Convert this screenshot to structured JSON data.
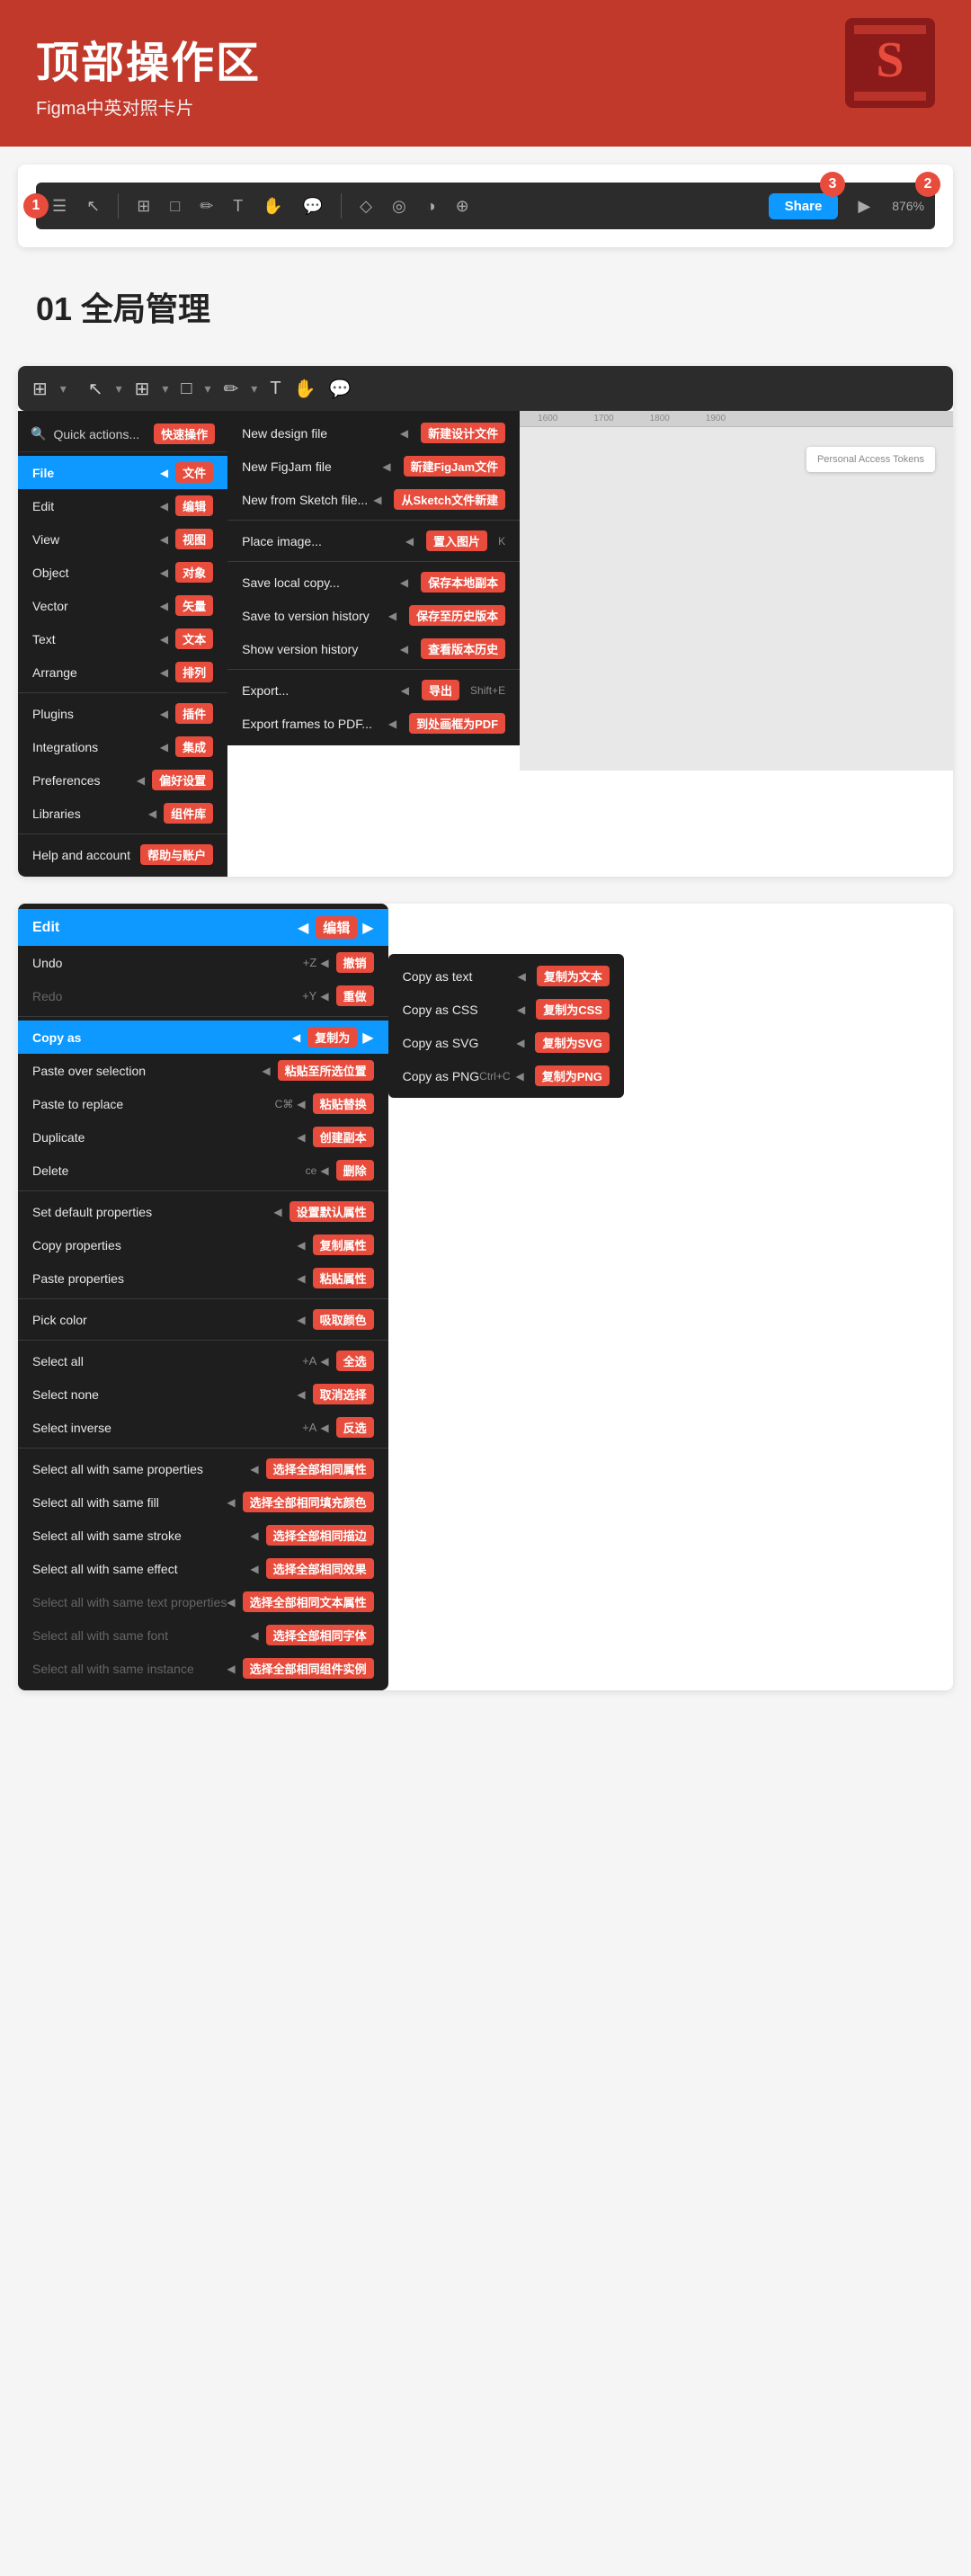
{
  "header": {
    "title": "顶部操作区",
    "subtitle": "Figma中英对照卡片"
  },
  "section01": {
    "label": "01 全局管理"
  },
  "toolbar": {
    "share_label": "Share",
    "zoom_label": "876%",
    "badge1": "1",
    "badge2": "2",
    "badge3": "3"
  },
  "mainMenu": {
    "search_text": "Quick actions...",
    "search_badge": "快速操作",
    "items": [
      {
        "id": "file",
        "en": "File",
        "cn": "文件",
        "active": true,
        "arrow": true
      },
      {
        "id": "edit",
        "en": "Edit",
        "cn": "编辑",
        "active": false,
        "arrow": true
      },
      {
        "id": "view",
        "en": "View",
        "cn": "视图",
        "active": false,
        "arrow": true
      },
      {
        "id": "object",
        "en": "Object",
        "cn": "对象",
        "active": false,
        "arrow": true
      },
      {
        "id": "vector",
        "en": "Vector",
        "cn": "矢量",
        "active": false,
        "arrow": true
      },
      {
        "id": "text",
        "en": "Text",
        "cn": "文本",
        "active": false,
        "arrow": true
      },
      {
        "id": "arrange",
        "en": "Arrange",
        "cn": "排列",
        "active": false,
        "arrow": true
      },
      {
        "id": "plugins",
        "en": "Plugins",
        "cn": "插件",
        "active": false,
        "arrow": true
      },
      {
        "id": "integrations",
        "en": "Integrations",
        "cn": "集成",
        "active": false,
        "arrow": true
      },
      {
        "id": "preferences",
        "en": "Preferences",
        "cn": "偏好设置",
        "active": false,
        "arrow": true
      },
      {
        "id": "libraries",
        "en": "Libraries",
        "cn": "组件库",
        "active": false,
        "arrow": true
      },
      {
        "id": "help",
        "en": "Help and account",
        "cn": "帮助与账户",
        "active": false,
        "arrow": false
      }
    ]
  },
  "fileMenu": {
    "items": [
      {
        "id": "new-design",
        "en": "New design file",
        "cn": "新建设计文件",
        "shortcut": "",
        "arrow": false
      },
      {
        "id": "new-figjam",
        "en": "New FigJam file",
        "cn": "新建FigJam文件",
        "shortcut": "",
        "arrow": false
      },
      {
        "id": "new-sketch",
        "en": "New from Sketch file...",
        "cn": "从Sketch文件新建",
        "shortcut": "",
        "arrow": false
      },
      {
        "id": "divider1",
        "type": "divider"
      },
      {
        "id": "place-image",
        "en": "Place image...",
        "cn": "置入图片",
        "shortcut": "K",
        "arrow": false
      },
      {
        "id": "divider2",
        "type": "divider"
      },
      {
        "id": "save-local",
        "en": "Save local copy...",
        "cn": "保存本地副本",
        "shortcut": "",
        "arrow": false
      },
      {
        "id": "save-version",
        "en": "Save to version history",
        "cn": "保存至历史版本",
        "shortcut": "",
        "arrow": false
      },
      {
        "id": "show-version",
        "en": "Show version history",
        "cn": "查看版本历史",
        "shortcut": "",
        "arrow": false
      },
      {
        "id": "divider3",
        "type": "divider"
      },
      {
        "id": "export",
        "en": "Export...",
        "cn": "导出",
        "shortcut": "Shift+E",
        "arrow": false
      },
      {
        "id": "export-pdf",
        "en": "Export frames to PDF...",
        "cn": "到处画框为PDF",
        "shortcut": "",
        "arrow": false
      }
    ]
  },
  "editSection": {
    "header_en": "Edit",
    "header_cn": "编辑",
    "items": [
      {
        "id": "undo",
        "en": "Undo",
        "cn": "撤销",
        "shortcut": "+Z",
        "active": false,
        "grayed": false
      },
      {
        "id": "redo",
        "en": "Redo",
        "cn": "重做",
        "shortcut": "+Y",
        "active": false,
        "grayed": true
      },
      {
        "id": "divider1",
        "type": "divider"
      },
      {
        "id": "copy-as",
        "en": "Copy as",
        "cn": "复制为",
        "active": true,
        "grayed": false,
        "arrow": true
      },
      {
        "id": "paste-over",
        "en": "Paste over selection",
        "cn": "粘贴至所选位置",
        "active": false,
        "grayed": false
      },
      {
        "id": "paste-replace",
        "en": "Paste to replace",
        "cn": "粘贴替换",
        "shortcut": "C⌘",
        "active": false,
        "grayed": false
      },
      {
        "id": "duplicate",
        "en": "Duplicate",
        "cn": "创建副本",
        "active": false,
        "grayed": false
      },
      {
        "id": "delete",
        "en": "Delete",
        "cn": "删除",
        "shortcut": "ce",
        "active": false,
        "grayed": false
      },
      {
        "id": "divider2",
        "type": "divider"
      },
      {
        "id": "set-default",
        "en": "Set default properties",
        "cn": "设置默认属性",
        "active": false,
        "grayed": false
      },
      {
        "id": "copy-props",
        "en": "Copy properties",
        "cn": "复制属性",
        "active": false,
        "grayed": false
      },
      {
        "id": "paste-props",
        "en": "Paste properties",
        "cn": "粘贴属性",
        "active": false,
        "grayed": false
      },
      {
        "id": "divider3",
        "type": "divider"
      },
      {
        "id": "pick-color",
        "en": "Pick color",
        "cn": "吸取颜色",
        "active": false,
        "grayed": false
      },
      {
        "id": "divider4",
        "type": "divider"
      },
      {
        "id": "select-all",
        "en": "Select all",
        "cn": "全选",
        "shortcut": "+A",
        "active": false,
        "grayed": false
      },
      {
        "id": "select-none",
        "en": "Select none",
        "cn": "取消选择",
        "active": false,
        "grayed": false
      },
      {
        "id": "select-inverse",
        "en": "Select inverse",
        "cn": "反选",
        "shortcut": "+A",
        "active": false,
        "grayed": false
      },
      {
        "id": "divider5",
        "type": "divider"
      },
      {
        "id": "select-same-props",
        "en": "Select all with same properties",
        "cn": "选择全部相同属性",
        "active": false,
        "grayed": false
      },
      {
        "id": "select-same-fill",
        "en": "Select all with same fill",
        "cn": "选择全部相同填充颜色",
        "active": false,
        "grayed": false
      },
      {
        "id": "select-same-stroke",
        "en": "Select all with same stroke",
        "cn": "选择全部相同描边",
        "active": false,
        "grayed": false
      },
      {
        "id": "select-same-effect",
        "en": "Select all with same effect",
        "cn": "选择全部相同效果",
        "active": false,
        "grayed": false
      },
      {
        "id": "select-same-text-props",
        "en": "Select all with same text properties",
        "cn": "选择全部相同文本属性",
        "active": false,
        "grayed": true
      },
      {
        "id": "select-same-font",
        "en": "Select all with same font",
        "cn": "选择全部相同字体",
        "active": false,
        "grayed": true
      },
      {
        "id": "select-same-instance",
        "en": "Select all with same instance",
        "cn": "选择全部相同组件实例",
        "active": false,
        "grayed": true
      }
    ]
  },
  "copyAsMenu": {
    "items": [
      {
        "id": "copy-text",
        "en": "Copy as text",
        "cn": "复制为文本",
        "shortcut": ""
      },
      {
        "id": "copy-css",
        "en": "Copy as CSS",
        "cn": "复制为CSS",
        "shortcut": ""
      },
      {
        "id": "copy-svg",
        "en": "Copy as SVG",
        "cn": "复制为SVG",
        "shortcut": ""
      },
      {
        "id": "copy-png",
        "en": "Copy as PNG",
        "cn": "复制为PNG",
        "shortcut": "Ctrl+C"
      }
    ]
  }
}
